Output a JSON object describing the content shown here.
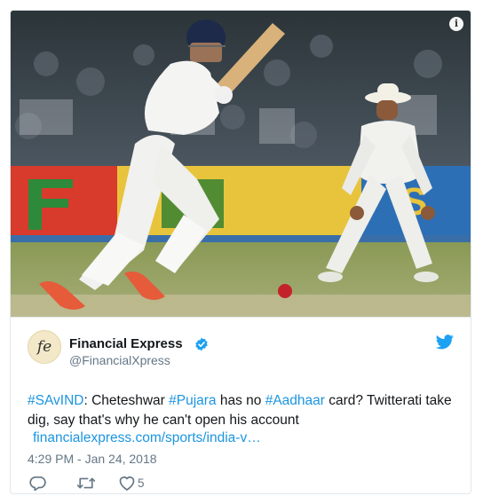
{
  "photo": {
    "info_icon": "info-icon",
    "scene": "cricket-photo"
  },
  "tweet": {
    "account_name": "Financial Express",
    "handle": "@FinancialXpress",
    "avatar_text": "fe",
    "verified_icon": "verified-badge-icon",
    "platform_icon": "twitter-bird-icon",
    "text": {
      "hashtag1": "#SAvIND",
      "part1": ": Cheteshwar ",
      "hashtag2": "#Pujara",
      "part2": " has no ",
      "hashtag3": "#Aadhaar",
      "part3": " card? Twitterati take dig, say that's why he can't open his account"
    },
    "link": "financialexpress.com/sports/india-v…",
    "timestamp": "4:29 PM - Jan 24, 2018",
    "actions": {
      "reply_icon": "reply-icon",
      "retweet_icon": "retweet-icon",
      "like_icon": "heart-icon",
      "like_count": "5"
    }
  },
  "colors": {
    "link": "#1b95e0",
    "text": "#14171a",
    "muted": "#657786",
    "border": "#e1e8ed"
  }
}
